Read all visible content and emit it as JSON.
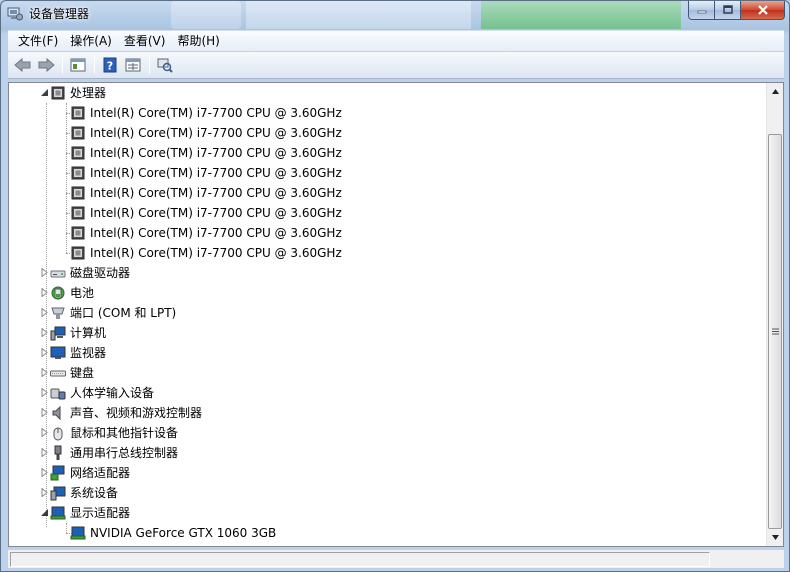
{
  "window": {
    "title": "设备管理器"
  },
  "menubar": {
    "items": [
      {
        "label": "文件(F)"
      },
      {
        "label": "操作(A)"
      },
      {
        "label": "查看(V)"
      },
      {
        "label": "帮助(H)"
      }
    ]
  },
  "toolbar": {
    "buttons": [
      "back-icon",
      "forward-icon",
      "show-hide-console-tree-icon",
      "help-icon",
      "properties-icon",
      "scan-hardware-icon"
    ]
  },
  "tree": {
    "processor_category": {
      "label": "处理器",
      "expanded": true
    },
    "processors": [
      "Intel(R) Core(TM) i7-7700 CPU @ 3.60GHz",
      "Intel(R) Core(TM) i7-7700 CPU @ 3.60GHz",
      "Intel(R) Core(TM) i7-7700 CPU @ 3.60GHz",
      "Intel(R) Core(TM) i7-7700 CPU @ 3.60GHz",
      "Intel(R) Core(TM) i7-7700 CPU @ 3.60GHz",
      "Intel(R) Core(TM) i7-7700 CPU @ 3.60GHz",
      "Intel(R) Core(TM) i7-7700 CPU @ 3.60GHz",
      "Intel(R) Core(TM) i7-7700 CPU @ 3.60GHz"
    ],
    "categories": [
      {
        "label": "磁盘驱动器",
        "icon": "disk-drive-icon"
      },
      {
        "label": "电池",
        "icon": "battery-icon"
      },
      {
        "label": "端口 (COM 和 LPT)",
        "icon": "port-icon"
      },
      {
        "label": "计算机",
        "icon": "computer-icon"
      },
      {
        "label": "监视器",
        "icon": "monitor-icon"
      },
      {
        "label": "键盘",
        "icon": "keyboard-icon"
      },
      {
        "label": "人体学输入设备",
        "icon": "hid-icon"
      },
      {
        "label": "声音、视频和游戏控制器",
        "icon": "speaker-icon"
      },
      {
        "label": "鼠标和其他指针设备",
        "icon": "mouse-icon"
      },
      {
        "label": "通用串行总线控制器",
        "icon": "usb-icon"
      },
      {
        "label": "网络适配器",
        "icon": "network-adapter-icon"
      },
      {
        "label": "系统设备",
        "icon": "system-device-icon"
      }
    ],
    "display_category": {
      "label": "显示适配器",
      "expanded": true
    },
    "display_devices": [
      "NVIDIA GeForce GTX 1060 3GB"
    ]
  }
}
